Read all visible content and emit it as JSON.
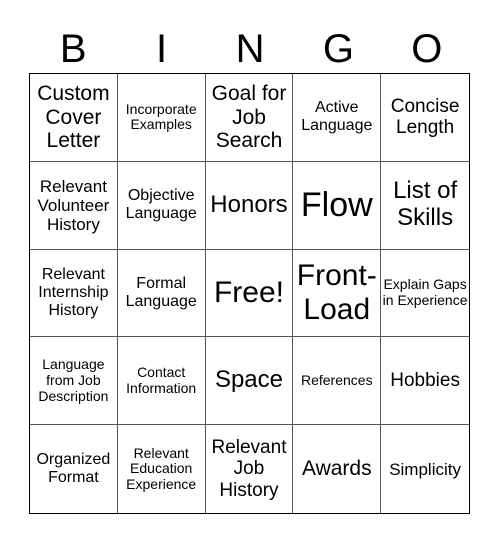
{
  "header": {
    "letters": [
      "B",
      "I",
      "N",
      "G",
      "O"
    ]
  },
  "card": {
    "cells": [
      "Custom Cover Letter",
      "Incorporate Examples",
      "Goal for Job Search",
      "Active Language",
      "Concise Length",
      "Relevant Volunteer History",
      "Objective Language",
      "Honors",
      "Flow",
      "List of Skills",
      "Relevant Internship History",
      "Formal Language",
      "Free!",
      "Front-Load",
      "Explain Gaps in Experience",
      "Language from Job Description",
      "Contact Information",
      "Space",
      "References",
      "Hobbies",
      "Organized Format",
      "Relevant Education Experience",
      "Relevant Job History",
      "Awards",
      "Simplicity"
    ]
  }
}
